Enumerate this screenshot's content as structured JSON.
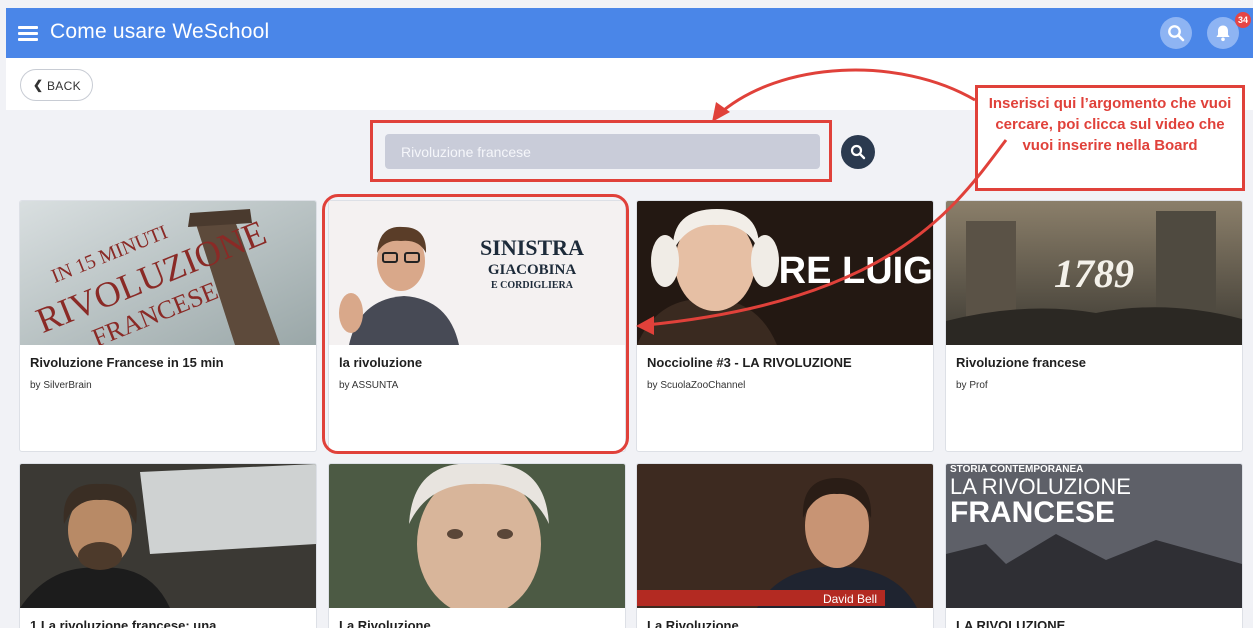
{
  "header": {
    "title": "Come usare WeSchool",
    "notification_count": "34",
    "menu_icon": "hamburger-icon",
    "search_icon": "search-icon",
    "bell_icon": "bell-icon",
    "bar_color": "#4a86e8"
  },
  "nav": {
    "back_label": "BACK",
    "back_icon": "chevron-left-icon"
  },
  "search": {
    "value": "",
    "placeholder": "Rivoluzione francese"
  },
  "annotation": {
    "callout_text": "Inserisci qui l’argomento che vuoi cercare, poi clicca sul video che vuoi inserire nella Board",
    "color": "#e0413a"
  },
  "videos": [
    {
      "title": "Rivoluzione Francese in 15 min",
      "author": "by SilverBrain",
      "thumb_text": [
        "IN 15 MINUTI",
        "RIVOLUZIONE",
        "FRANCESE"
      ]
    },
    {
      "title": "la rivoluzione",
      "author": "by ASSUNTA",
      "thumb_text": [
        "SINISTRA",
        "GIACOBINA",
        "E CORDIGLIERA"
      ]
    },
    {
      "title": "Noccioline #3 - LA RIVOLUZIONE",
      "author": "by ScuolaZooChannel",
      "thumb_text": [
        "RE LUIGI"
      ]
    },
    {
      "title": "Rivoluzione francese",
      "author": "by Prof",
      "thumb_text": [
        "1789"
      ]
    },
    {
      "title": "1 La rivoluzione francese: una",
      "author": "",
      "thumb_text": []
    },
    {
      "title": "La Rivoluzione",
      "author": "",
      "thumb_text": []
    },
    {
      "title": "La Rivoluzione",
      "author": "",
      "thumb_text": [
        "David Bell"
      ]
    },
    {
      "title": "LA RIVOLUZIONE",
      "author": "",
      "thumb_text": [
        "STORIA CONTEMPORANEA",
        "LA RIVOLUZIONE",
        "FRANCESE"
      ]
    }
  ]
}
